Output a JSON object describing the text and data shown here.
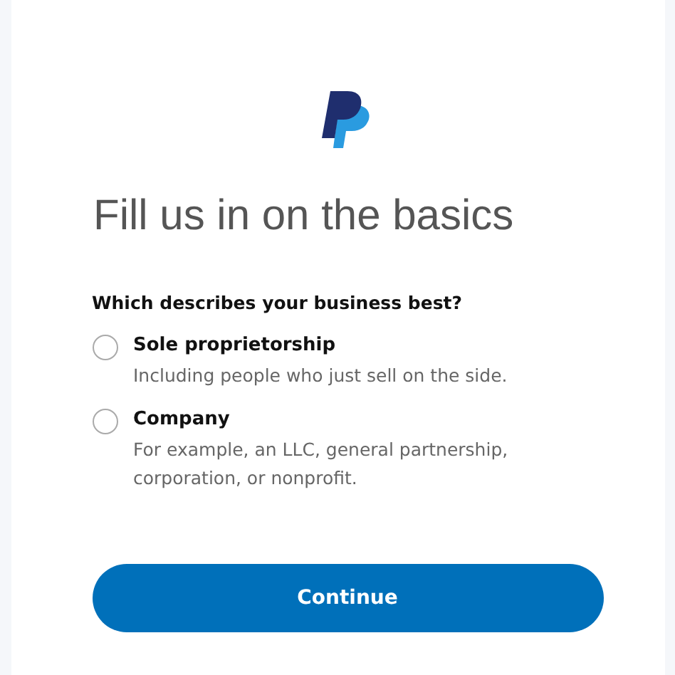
{
  "heading": "Fill us in on the basics",
  "question": "Which describes your business best?",
  "options": [
    {
      "label": "Sole proprietorship",
      "description": "Including people who just sell on the side.",
      "selected": false
    },
    {
      "label": "Company",
      "description": "For example, an LLC, general partnership, corporation, or nonprofit.",
      "selected": false
    }
  ],
  "button": "Continue"
}
